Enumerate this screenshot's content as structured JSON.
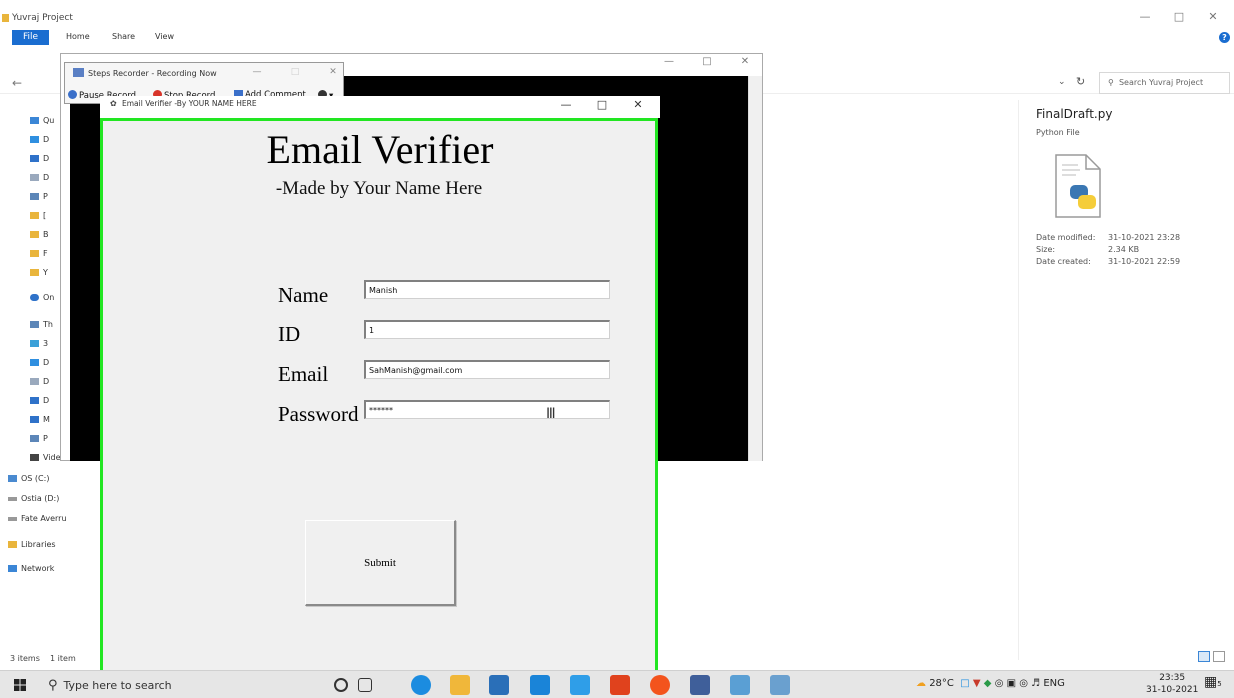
{
  "explorer": {
    "title": "Yuvraj Project",
    "ribbon_tabs": [
      "File",
      "Home",
      "Share",
      "View"
    ],
    "search_placeholder": "Search Yuvraj Project",
    "nav_items": [
      "Qu",
      "D",
      "D",
      "D",
      "P",
      "[",
      "B",
      "F",
      "Y",
      "On",
      "Th",
      "3",
      "D",
      "D",
      "D",
      "M",
      "P",
      "Videos",
      "OS (C:)",
      "Ostia (D:)",
      "Fate Averru",
      "Libraries",
      "Network"
    ],
    "details": {
      "file_name": "FinalDraft.py",
      "file_type": "Python File",
      "date_modified_label": "Date modified:",
      "date_modified": "31-10-2021 23:28",
      "size_label": "Size:",
      "size": "2.34 KB",
      "date_created_label": "Date created:",
      "date_created": "31-10-2021 22:59"
    },
    "status_items": "3 items",
    "status_selected": "1 item"
  },
  "steps_recorder": {
    "title": "Steps Recorder - Recording Now",
    "pause_label": "Pause Record",
    "stop_label": "Stop Record",
    "comment_label": "Add Comment"
  },
  "email_verifier": {
    "window_title": "Email Verifier -By YOUR NAME HERE",
    "heading": "Email Verifier",
    "subheading": "-Made by Your Name Here",
    "fields": [
      {
        "label": "Name",
        "value": "Manish"
      },
      {
        "label": "ID",
        "value": "1"
      },
      {
        "label": "Email",
        "value": "SahManish@gmail.com"
      },
      {
        "label": "Password",
        "value": "******"
      }
    ],
    "submit_label": "Submit"
  },
  "taskbar": {
    "search_placeholder": "Type here to search",
    "weather": "28°C",
    "language": "ENG",
    "time": "23:35",
    "date": "31-10-2021",
    "notification_count": "5"
  },
  "colors": {
    "highlight_frame": "#22e622",
    "accent": "#1a6dd0"
  }
}
